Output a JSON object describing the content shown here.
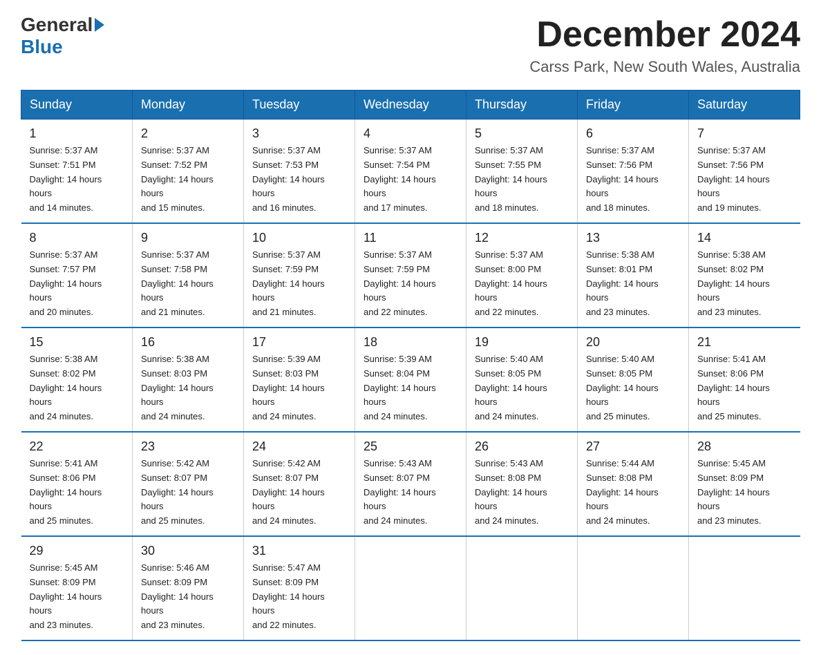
{
  "header": {
    "logo_general": "General",
    "logo_blue": "Blue",
    "month_title": "December 2024",
    "location": "Carss Park, New South Wales, Australia"
  },
  "days_of_week": [
    "Sunday",
    "Monday",
    "Tuesday",
    "Wednesday",
    "Thursday",
    "Friday",
    "Saturday"
  ],
  "weeks": [
    [
      {
        "day": "1",
        "sunrise": "5:37 AM",
        "sunset": "7:51 PM",
        "daylight": "14 hours and 14 minutes."
      },
      {
        "day": "2",
        "sunrise": "5:37 AM",
        "sunset": "7:52 PM",
        "daylight": "14 hours and 15 minutes."
      },
      {
        "day": "3",
        "sunrise": "5:37 AM",
        "sunset": "7:53 PM",
        "daylight": "14 hours and 16 minutes."
      },
      {
        "day": "4",
        "sunrise": "5:37 AM",
        "sunset": "7:54 PM",
        "daylight": "14 hours and 17 minutes."
      },
      {
        "day": "5",
        "sunrise": "5:37 AM",
        "sunset": "7:55 PM",
        "daylight": "14 hours and 18 minutes."
      },
      {
        "day": "6",
        "sunrise": "5:37 AM",
        "sunset": "7:56 PM",
        "daylight": "14 hours and 18 minutes."
      },
      {
        "day": "7",
        "sunrise": "5:37 AM",
        "sunset": "7:56 PM",
        "daylight": "14 hours and 19 minutes."
      }
    ],
    [
      {
        "day": "8",
        "sunrise": "5:37 AM",
        "sunset": "7:57 PM",
        "daylight": "14 hours and 20 minutes."
      },
      {
        "day": "9",
        "sunrise": "5:37 AM",
        "sunset": "7:58 PM",
        "daylight": "14 hours and 21 minutes."
      },
      {
        "day": "10",
        "sunrise": "5:37 AM",
        "sunset": "7:59 PM",
        "daylight": "14 hours and 21 minutes."
      },
      {
        "day": "11",
        "sunrise": "5:37 AM",
        "sunset": "7:59 PM",
        "daylight": "14 hours and 22 minutes."
      },
      {
        "day": "12",
        "sunrise": "5:37 AM",
        "sunset": "8:00 PM",
        "daylight": "14 hours and 22 minutes."
      },
      {
        "day": "13",
        "sunrise": "5:38 AM",
        "sunset": "8:01 PM",
        "daylight": "14 hours and 23 minutes."
      },
      {
        "day": "14",
        "sunrise": "5:38 AM",
        "sunset": "8:02 PM",
        "daylight": "14 hours and 23 minutes."
      }
    ],
    [
      {
        "day": "15",
        "sunrise": "5:38 AM",
        "sunset": "8:02 PM",
        "daylight": "14 hours and 24 minutes."
      },
      {
        "day": "16",
        "sunrise": "5:38 AM",
        "sunset": "8:03 PM",
        "daylight": "14 hours and 24 minutes."
      },
      {
        "day": "17",
        "sunrise": "5:39 AM",
        "sunset": "8:03 PM",
        "daylight": "14 hours and 24 minutes."
      },
      {
        "day": "18",
        "sunrise": "5:39 AM",
        "sunset": "8:04 PM",
        "daylight": "14 hours and 24 minutes."
      },
      {
        "day": "19",
        "sunrise": "5:40 AM",
        "sunset": "8:05 PM",
        "daylight": "14 hours and 24 minutes."
      },
      {
        "day": "20",
        "sunrise": "5:40 AM",
        "sunset": "8:05 PM",
        "daylight": "14 hours and 25 minutes."
      },
      {
        "day": "21",
        "sunrise": "5:41 AM",
        "sunset": "8:06 PM",
        "daylight": "14 hours and 25 minutes."
      }
    ],
    [
      {
        "day": "22",
        "sunrise": "5:41 AM",
        "sunset": "8:06 PM",
        "daylight": "14 hours and 25 minutes."
      },
      {
        "day": "23",
        "sunrise": "5:42 AM",
        "sunset": "8:07 PM",
        "daylight": "14 hours and 25 minutes."
      },
      {
        "day": "24",
        "sunrise": "5:42 AM",
        "sunset": "8:07 PM",
        "daylight": "14 hours and 24 minutes."
      },
      {
        "day": "25",
        "sunrise": "5:43 AM",
        "sunset": "8:07 PM",
        "daylight": "14 hours and 24 minutes."
      },
      {
        "day": "26",
        "sunrise": "5:43 AM",
        "sunset": "8:08 PM",
        "daylight": "14 hours and 24 minutes."
      },
      {
        "day": "27",
        "sunrise": "5:44 AM",
        "sunset": "8:08 PM",
        "daylight": "14 hours and 24 minutes."
      },
      {
        "day": "28",
        "sunrise": "5:45 AM",
        "sunset": "8:09 PM",
        "daylight": "14 hours and 23 minutes."
      }
    ],
    [
      {
        "day": "29",
        "sunrise": "5:45 AM",
        "sunset": "8:09 PM",
        "daylight": "14 hours and 23 minutes."
      },
      {
        "day": "30",
        "sunrise": "5:46 AM",
        "sunset": "8:09 PM",
        "daylight": "14 hours and 23 minutes."
      },
      {
        "day": "31",
        "sunrise": "5:47 AM",
        "sunset": "8:09 PM",
        "daylight": "14 hours and 22 minutes."
      },
      null,
      null,
      null,
      null
    ]
  ],
  "sunrise_label": "Sunrise:",
  "sunset_label": "Sunset:",
  "daylight_label": "Daylight:"
}
